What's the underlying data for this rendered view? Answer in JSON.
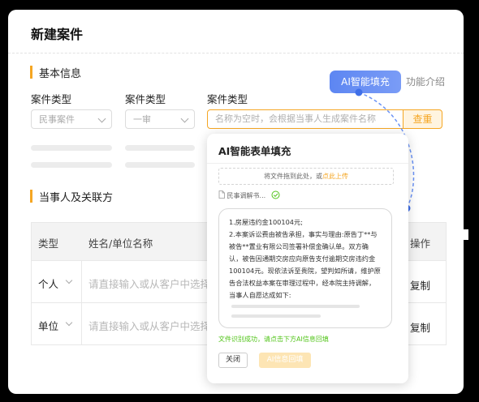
{
  "window": {
    "title": "新建案件"
  },
  "basic_info": {
    "section_title": "基本信息",
    "fields": [
      {
        "label": "案件类型",
        "value": "民事案件"
      },
      {
        "label": "案件类型",
        "value": "一审"
      },
      {
        "label": "案件类型",
        "placeholder": "名称为空时，会根据当事人生成案件名称"
      }
    ],
    "query_label": "查重",
    "ai_fill_label": "AI智能填充",
    "feature_intro_label": "功能介绍"
  },
  "parties": {
    "section_title": "当事人及关联方",
    "columns": [
      "类型",
      "姓名/单位名称",
      "操作"
    ],
    "rows": [
      {
        "type": "个人",
        "placeholder": "请直接输入或从客户中选择",
        "action": "复制"
      },
      {
        "type": "单位",
        "placeholder": "请直接输入或从客户中选择",
        "action": "复制"
      }
    ]
  },
  "ai_popup": {
    "title": "AI智能表单填充",
    "dropzone_text": "将文件拖到此处，或",
    "dropzone_link": "点此上传",
    "file_name": "民事调解书...",
    "content": "1.房屋违约金100104元;\n2.本案诉讼费由被告承担，事实与理由:原告丁**与被告**置业有限公司签署补偿金确认单。双方确认，被告因通期交房应向原告支付逾期交房违约金100104元。现依法诉至贵院，望判如所请，维护原告合法权益本案在审理过程中，经本院主持调解，当事人自愿达成如下:",
    "status_message": "文件识别成功，请点击下方AI信息回填",
    "close_label": "关闭",
    "backfill_label": "AI信息回填"
  },
  "colors": {
    "accent_orange": "#f5a623",
    "ai_blue": "#5d86f2",
    "success_green": "#52c41a"
  }
}
